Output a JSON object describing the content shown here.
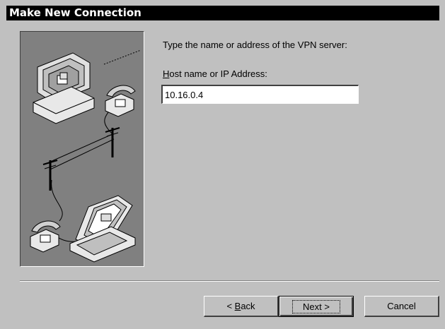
{
  "window": {
    "title": "Make New Connection"
  },
  "content": {
    "prompt": "Type the name or address of the VPN server:",
    "field_label_accel": "H",
    "field_label_rest": "ost name or IP Address:",
    "host_value": "10.16.0.4"
  },
  "buttons": {
    "back_prefix": "< ",
    "back_accel": "B",
    "back_rest": "ack",
    "next": "Next >",
    "cancel": "Cancel"
  },
  "illustration": {
    "icons": [
      "computer-icon",
      "telephone-icon",
      "telephone-pole-icon",
      "laptop-icon"
    ]
  }
}
